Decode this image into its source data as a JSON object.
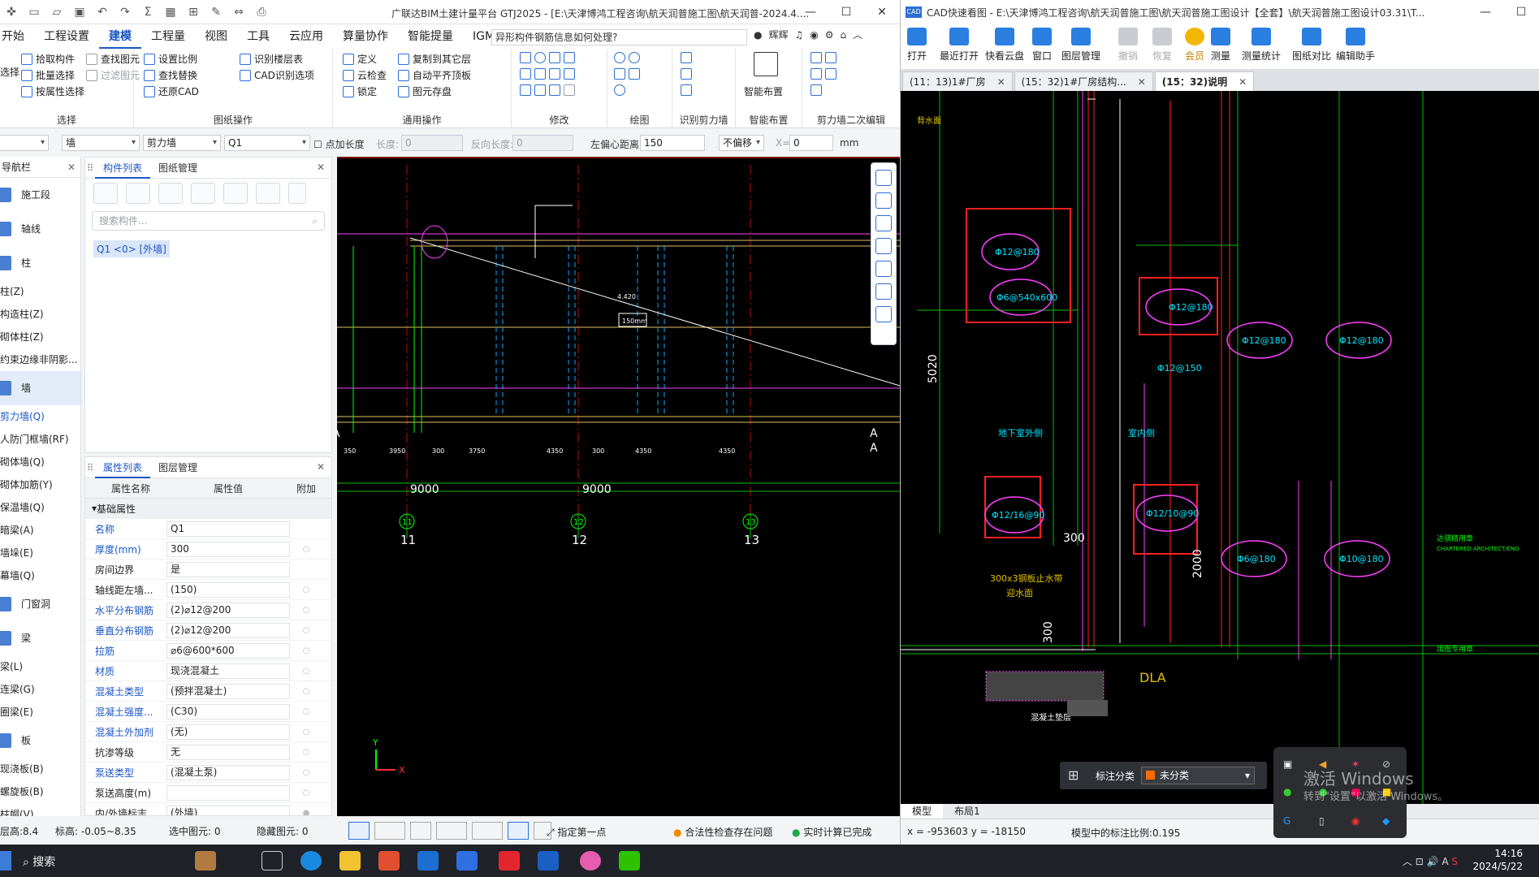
{
  "gtj": {
    "title": "广联达BIM土建计量平台 GTJ2025 - [E:\\天津博鸿工程咨询\\航天润普施工图\\航天润普-2024.4....",
    "window_controls": [
      "—",
      "☐",
      "✕"
    ],
    "menus": [
      "开始",
      "工程设置",
      "建模",
      "工程量",
      "视图",
      "工具",
      "云应用",
      "算量协作",
      "智能提量",
      "IGMS"
    ],
    "active_menu": "建模",
    "search_text": "异形构件钢筋信息如何处理?",
    "user": "辉辉",
    "ribbon_groups": {
      "select": {
        "label": "选择",
        "items": [
          "拾取构件",
          "批量选择",
          "按属性选择",
          "查找图元",
          "过滤图元"
        ],
        "first": "选择"
      },
      "drawing_ops": {
        "label": "图纸操作",
        "items": [
          "设置比例",
          "识别楼层表",
          "查找替换",
          "CAD识别选项",
          "还原CAD"
        ]
      },
      "common_ops": {
        "label": "通用操作",
        "items": [
          "定义",
          "复制到其它层",
          "云检查",
          "自动平齐顶板",
          "锁定",
          "图元存盘"
        ]
      },
      "modify": {
        "label": "修改"
      },
      "draw": {
        "label": "绘图"
      },
      "shear_wall_id": {
        "label": "识别剪力墙"
      },
      "smart_layout": {
        "label": "智能布置",
        "button": "智能布置"
      },
      "shear_wall_edit": {
        "label": "剪力墙二次编辑"
      }
    },
    "propbar": {
      "type1": "墙",
      "type2": "剪力墙",
      "name": "Q1",
      "point_length_label": "点加长度",
      "length_label": "长度:",
      "length_value": "0",
      "reverse_length_label": "反向长度:",
      "reverse_length_value": "0",
      "offset_label": "左偏心距离:",
      "offset_value": "150",
      "offset_mode": "不偏移",
      "x_label": "X=",
      "x_value": "0",
      "unit": "mm"
    },
    "nav": {
      "title": "导航栏",
      "items": [
        {
          "label": "施工段",
          "group": true
        },
        {
          "label": "轴线",
          "group": true
        },
        {
          "label": "柱",
          "group": true
        },
        {
          "label": "柱(Z)"
        },
        {
          "label": "构造柱(Z)"
        },
        {
          "label": "砌体柱(Z)"
        },
        {
          "label": "约束边缘非阴影..."
        },
        {
          "label": "墙",
          "group": true,
          "selected": true
        },
        {
          "label": "剪力墙(Q)",
          "active": true
        },
        {
          "label": "人防门框墙(RF)"
        },
        {
          "label": "砌体墙(Q)"
        },
        {
          "label": "砌体加筋(Y)"
        },
        {
          "label": "保温墙(Q)"
        },
        {
          "label": "暗梁(A)"
        },
        {
          "label": "墙垛(E)"
        },
        {
          "label": "幕墙(Q)"
        },
        {
          "label": "门窗洞",
          "group": true
        },
        {
          "label": "梁",
          "group": true
        },
        {
          "label": "梁(L)"
        },
        {
          "label": "连梁(G)"
        },
        {
          "label": "圈梁(E)"
        },
        {
          "label": "板",
          "group": true
        },
        {
          "label": "现浇板(B)"
        },
        {
          "label": "螺旋板(B)"
        },
        {
          "label": "柱帽(V)"
        }
      ]
    },
    "component_list": {
      "tabs": [
        "构件列表",
        "图纸管理"
      ],
      "search_placeholder": "搜索构件...",
      "item": "Q1 <0> [外墙]"
    },
    "property_list": {
      "tabs": [
        "属性列表",
        "图层管理"
      ],
      "headers": [
        "属性名称",
        "属性值",
        "附加"
      ],
      "section": "基础属性",
      "rows": [
        {
          "name": "名称",
          "value": "Q1",
          "blue": true
        },
        {
          "name": "厚度(mm)",
          "value": "300",
          "blue": true
        },
        {
          "name": "房间边界",
          "value": "是",
          "blue": false
        },
        {
          "name": "轴线距左墙...",
          "value": "(150)",
          "blue": false
        },
        {
          "name": "水平分布钢筋",
          "value": "(2)⌀12@200",
          "blue": true
        },
        {
          "name": "垂直分布钢筋",
          "value": "(2)⌀12@200",
          "blue": true
        },
        {
          "name": "拉筋",
          "value": "⌀6@600*600",
          "blue": true
        },
        {
          "name": "材质",
          "value": "现浇混凝土",
          "blue": true
        },
        {
          "name": "混凝土类型",
          "value": "(预拌混凝土)",
          "blue": true
        },
        {
          "name": "混凝土强度...",
          "value": "(C30)",
          "blue": true
        },
        {
          "name": "混凝土外加剂",
          "value": "(无)",
          "blue": true
        },
        {
          "name": "抗渗等级",
          "value": "无",
          "blue": false
        },
        {
          "name": "泵送类型",
          "value": "(混凝土泵)",
          "blue": true
        },
        {
          "name": "泵送高度(m)",
          "value": "",
          "blue": false
        },
        {
          "name": "内/外墙标志",
          "value": "(外墙)",
          "blue": false
        }
      ]
    },
    "cad": {
      "axes": [
        "11",
        "12",
        "13"
      ],
      "dims_big": [
        "9000",
        "9000"
      ],
      "dims_small": [
        "350",
        "3950",
        "300",
        "3750",
        "4350",
        "300",
        "4350",
        "4350"
      ],
      "labels": [
        "A",
        "A",
        "A"
      ],
      "elev": "4.420",
      "box_label": "150mm"
    },
    "status": {
      "layer_height_label": "层高:",
      "layer_height": "8.4",
      "elev_label": "标高:",
      "elev": "-0.05~8.35",
      "selected_label": "选中图元:",
      "selected": "0",
      "hidden_label": "隐藏图元:",
      "hidden": "0",
      "hint": "指定第一点",
      "check_status": "合法性检查存在问题",
      "calc_status": "实时计算已完成"
    }
  },
  "cad_viewer": {
    "title": "CAD快速看图 - E:\\天津博鸿工程咨询\\航天润普施工图\\航天润普施工图设计【全套】\\航天润普施工图设计03.31\\T...",
    "tools": [
      {
        "label": "打开",
        "state": "normal"
      },
      {
        "label": "最近打开",
        "state": "normal"
      },
      {
        "label": "快看云盘",
        "state": "normal"
      },
      {
        "label": "窗口",
        "state": "normal"
      },
      {
        "label": "图层管理",
        "state": "normal"
      },
      {
        "label": "撤销",
        "state": "disabled"
      },
      {
        "label": "恢复",
        "state": "disabled"
      },
      {
        "label": "会员",
        "state": "vip"
      },
      {
        "label": "测量",
        "state": "normal"
      },
      {
        "label": "测量统计",
        "state": "normal"
      },
      {
        "label": "图纸对比",
        "state": "normal"
      },
      {
        "label": "编辑助手",
        "state": "normal"
      }
    ],
    "tabs": [
      {
        "label": "(11：13)1#厂房",
        "active": false
      },
      {
        "label": "(15：32)1#厂房结构...",
        "active": false
      },
      {
        "label": "(15：32)说明",
        "active": true
      }
    ],
    "drawing_labels": [
      "Φ12@180",
      "Φ6@540x600",
      "Φ12@180",
      "Φ12@150",
      "Φ12@180",
      "Φ12@180",
      "Φ12/16@90",
      "Φ12/10@90",
      "Φ6@180",
      "Φ10@180"
    ],
    "dims": [
      "5020",
      "300",
      "2000",
      "300"
    ],
    "text_notes": [
      "DLA",
      "300x3钢板止水带",
      "迎水面",
      "背水面",
      "地下室外侧",
      "室内侧",
      "混凝土垫层",
      "达骐精用章",
      "CHARTERED ARCHITECT/ENG",
      "出图专用章"
    ],
    "layout_tabs": [
      "模型",
      "布局1"
    ],
    "coords": "x = -953603  y = -18150",
    "scale": "模型中的标注比例:0.195",
    "annotation": {
      "label": "标注分类",
      "value": "未分类"
    }
  },
  "activation": {
    "line1": "激活 Windows",
    "line2": "转到\"设置\"以激活 Windows。"
  },
  "taskbar": {
    "search": "搜索",
    "time": "14:16",
    "date": "2024/5/22",
    "ime": "A",
    "wps": "S"
  }
}
